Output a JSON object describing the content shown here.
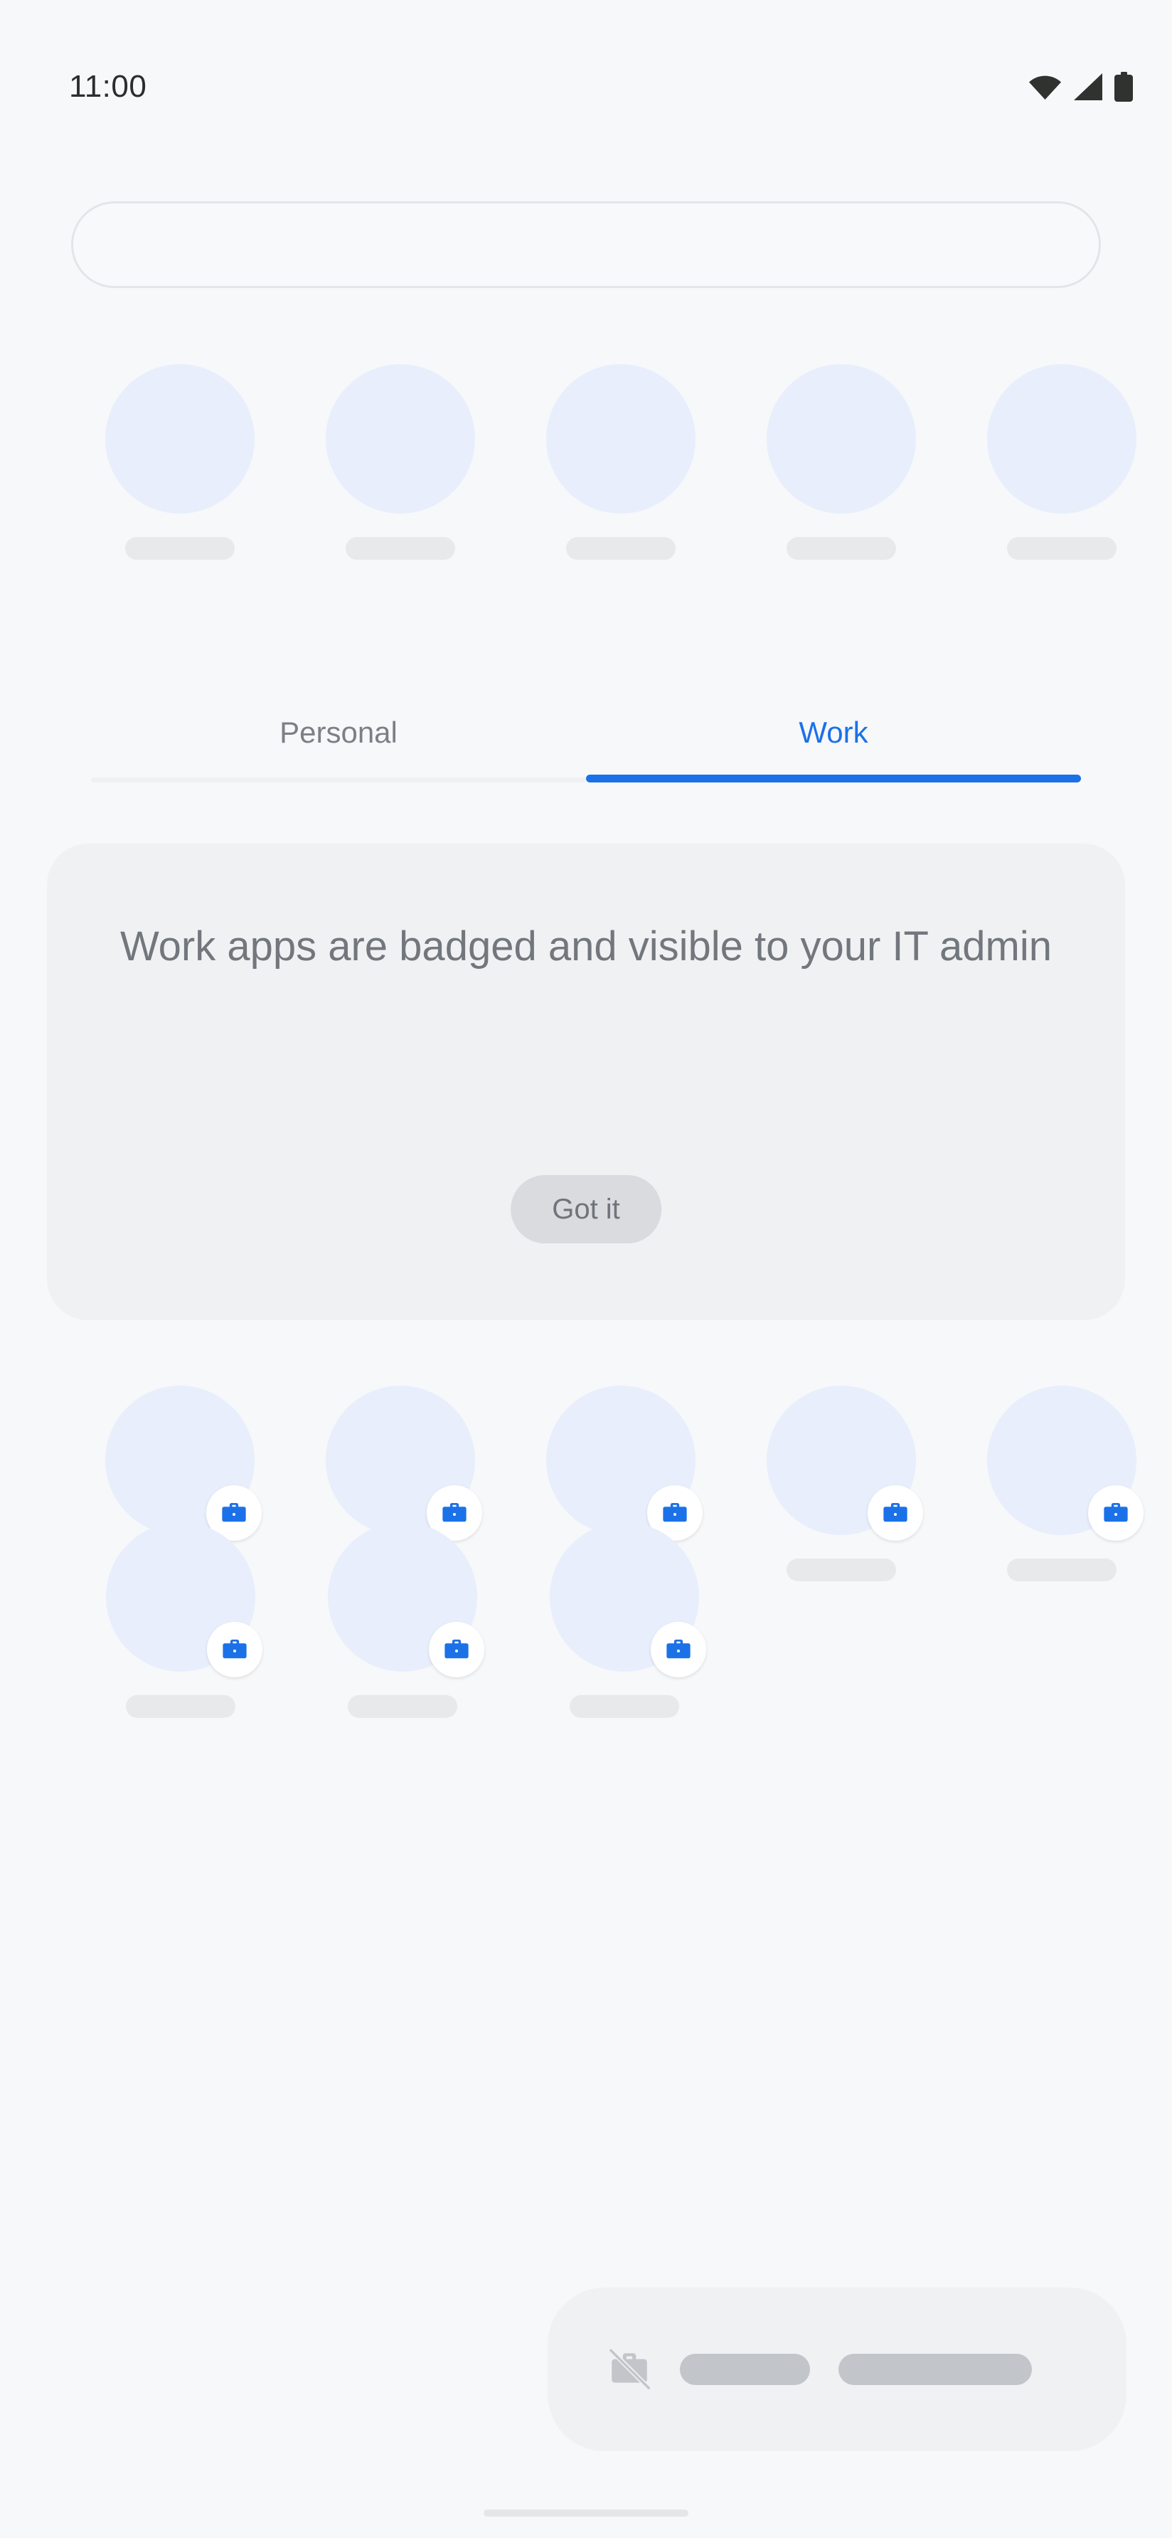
{
  "status_bar": {
    "time": "11:00",
    "icons": [
      "wifi-icon",
      "cell-signal-icon",
      "battery-full-icon"
    ]
  },
  "search": {
    "value": "",
    "placeholder": ""
  },
  "tabs": {
    "items": [
      {
        "label": "Personal",
        "selected": false
      },
      {
        "label": "Work",
        "selected": true
      }
    ],
    "active_color": "#1b71e8",
    "inactive_color": "#7c8085"
  },
  "info_card": {
    "message": "Work apps are badged and visible to your IT admin",
    "button_label": "Got it",
    "background": "#f0f1f3",
    "text_color": "#72777d"
  },
  "app_rows": {
    "suggestions": {
      "count": 5,
      "badged": false,
      "circle_color": "#e8eefb",
      "label_color": "#e7e9eb"
    },
    "work_row_1": {
      "count": 5,
      "badged": true,
      "badge_icon": "work-briefcase-icon",
      "badge_color": "#1b71e8",
      "circle_color": "#e8eefb",
      "label_color": "#e7e9eb"
    },
    "work_row_2": {
      "count": 3,
      "badged": true,
      "badge_icon": "work-briefcase-icon",
      "badge_color": "#1b71e8",
      "circle_color": "#e8eefb",
      "label_color": "#e7e9eb"
    }
  },
  "dock_card": {
    "icon": "briefcase-off-icon",
    "placeholder_bars": 2,
    "background": "#f0f1f3",
    "bar_color": "#c2c5ca"
  },
  "home_indicator": {
    "color": "#e4e6e8"
  }
}
